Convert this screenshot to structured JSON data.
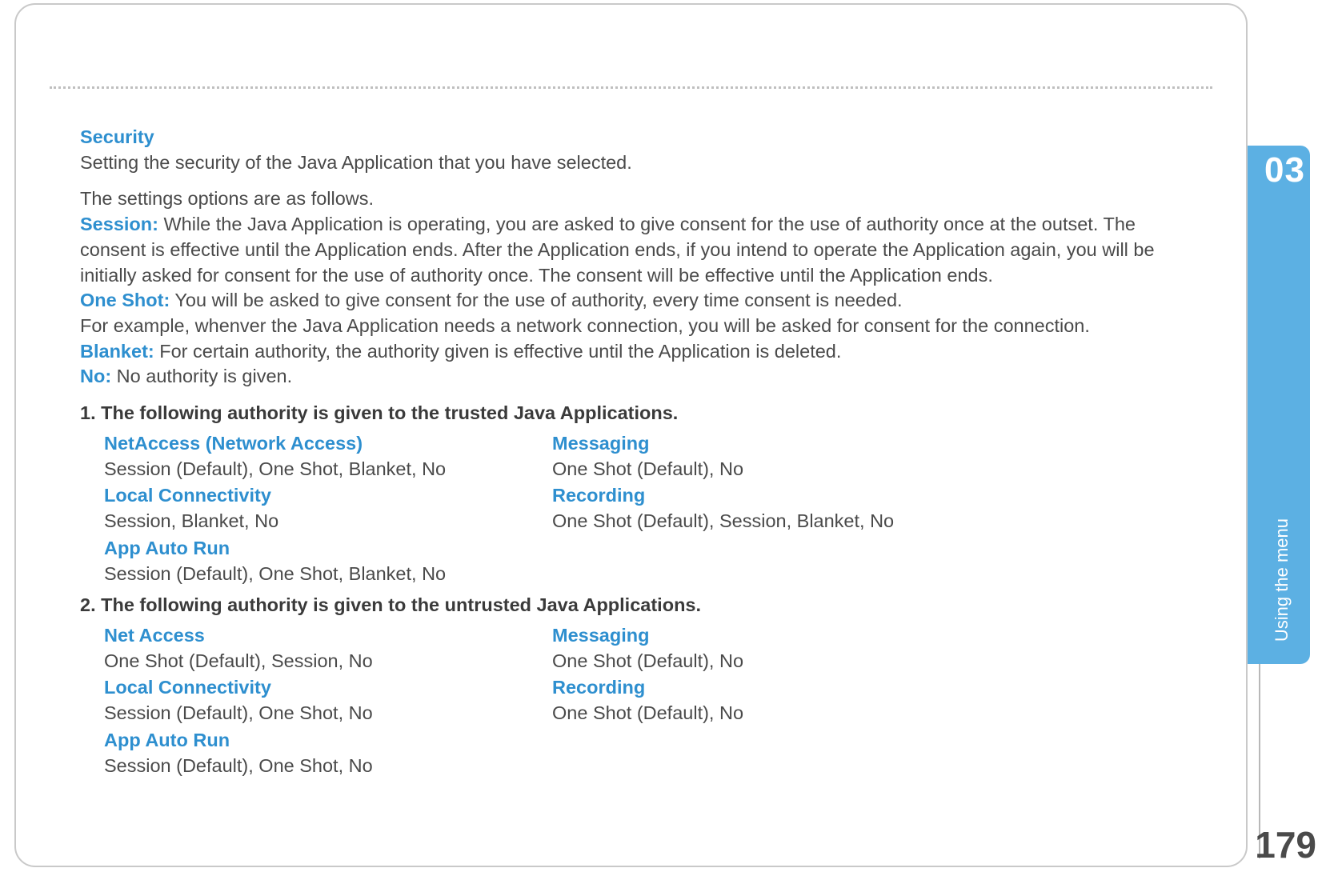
{
  "chapter_number": "03",
  "side_label": "Using the menu",
  "page_number": "179",
  "h_security": "Security",
  "p_security_1": "Setting the security of the Java Application that you have selected.",
  "p_options_intro": "The settings options are as follows.",
  "lbl_session": "Session:",
  "txt_session": " While the Java Application is operating, you are asked to give consent for the use of authority once at the outset. The consent is effective until the Application ends. After the Application ends, if you intend to operate the Application again, you will be initially asked for consent for the use of authority once. The consent will be effective until the Application ends.",
  "lbl_oneshot": "One Shot:",
  "txt_oneshot": " You will be asked to give consent for the use of authority, every time consent is needed.",
  "txt_oneshot_ex": "For example, whenver the Java Application needs a network connection, you will be asked for consent for the connection.",
  "lbl_blanket": "Blanket:",
  "txt_blanket": " For certain authority, the authority given is effective until the Application is deleted.",
  "lbl_no": "No:",
  "txt_no": " No authority is given.",
  "list1_head": "1. The following authority is given to the trusted Java Applications.",
  "list2_head": "2. The following authority is given to the untrusted Java Applications.",
  "t1": {
    "netaccess_t": "NetAccess (Network Access)",
    "netaccess_v": "Session (Default), One Shot, Blanket, No",
    "local_t": "Local Connectivity",
    "local_v": "Session, Blanket, No",
    "auto_t": "App Auto Run",
    "auto_v": "Session (Default), One Shot, Blanket, No",
    "msg_t": "Messaging",
    "msg_v": "One Shot (Default), No",
    "rec_t": "Recording",
    "rec_v": "One Shot (Default), Session, Blanket, No"
  },
  "t2": {
    "netaccess_t": "Net Access",
    "netaccess_v": "One Shot (Default), Session, No",
    "local_t": "Local Connectivity",
    "local_v": "Session (Default), One Shot, No",
    "auto_t": "App Auto Run",
    "auto_v": "Session (Default), One Shot, No",
    "msg_t": "Messaging",
    "msg_v": "One Shot (Default), No",
    "rec_t": "Recording",
    "rec_v": "One Shot (Default), No"
  }
}
